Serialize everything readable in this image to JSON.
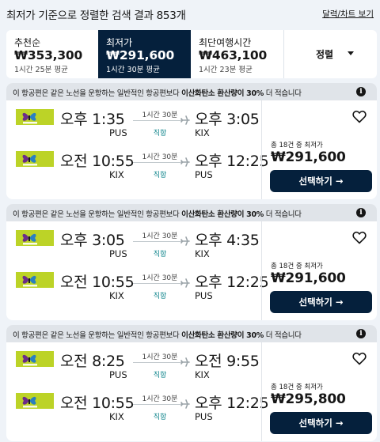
{
  "header": {
    "title": "최저가 기준으로 정렬한 검색 결과 853개",
    "chart_link": "달력/차트 보기"
  },
  "sort_tabs": [
    {
      "label": "추천순",
      "price": "₩353,300",
      "sub": "1시간 25분 평균",
      "active": false
    },
    {
      "label": "최저가",
      "price": "₩291,600",
      "sub": "1시간 30분 평균",
      "active": true
    },
    {
      "label": "최단여행시간",
      "price": "₩463,100",
      "sub": "1시간 23분 평균",
      "active": false
    }
  ],
  "sort_button": {
    "label": "정렬",
    "icon": "caret-down-icon"
  },
  "banner": {
    "prefix": "이 항공편은 같은 노선을 운항하는 일반적인 항공편보다 ",
    "highlight": "이산화탄소 환산량이 30%",
    "suffix": " 더 적습니다",
    "icon": "info-icon"
  },
  "select_label": "선택하기 →",
  "cards": [
    {
      "legs": [
        {
          "dep_time": "오후 1:35",
          "dep_code": "PUS",
          "duration": "1시간 30분",
          "stops": "직항",
          "arr_time": "오후 3:05",
          "arr_code": "KIX"
        },
        {
          "dep_time": "오전 10:55",
          "dep_code": "KIX",
          "duration": "1시간 30분",
          "stops": "직항",
          "arr_time": "오후 12:25",
          "arr_code": "PUS"
        }
      ],
      "deal_label": "총 18건 중 최저가",
      "price": "₩291,600"
    },
    {
      "legs": [
        {
          "dep_time": "오후 3:05",
          "dep_code": "PUS",
          "duration": "1시간 30분",
          "stops": "직항",
          "arr_time": "오후 4:35",
          "arr_code": "KIX"
        },
        {
          "dep_time": "오전 10:55",
          "dep_code": "KIX",
          "duration": "1시간 30분",
          "stops": "직항",
          "arr_time": "오후 12:25",
          "arr_code": "PUS"
        }
      ],
      "deal_label": "총 18건 중 최저가",
      "price": "₩291,600"
    },
    {
      "legs": [
        {
          "dep_time": "오전 8:25",
          "dep_code": "PUS",
          "duration": "1시간 30분",
          "stops": "직항",
          "arr_time": "오전 9:55",
          "arr_code": "KIX"
        },
        {
          "dep_time": "오전 10:55",
          "dep_code": "KIX",
          "duration": "1시간 30분",
          "stops": "직항",
          "arr_time": "오후 12:25",
          "arr_code": "PUS"
        }
      ],
      "deal_label": "총 18건 중 최저가",
      "price": "₩295,800"
    }
  ],
  "colors": {
    "accent_navy": "#05203c",
    "background": "#eff3f8",
    "banner": "#e0e4e9",
    "direct_teal": "#0c838a",
    "airline_logo": "#bcd327"
  },
  "icons": {
    "airline_logo": "jin-air-logo",
    "plane": "plane-icon",
    "heart": "heart-icon"
  }
}
